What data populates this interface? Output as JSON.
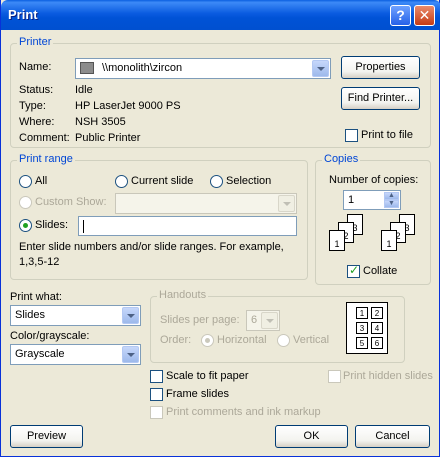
{
  "window": {
    "title": "Print",
    "help_label": "?",
    "close_label": "✕"
  },
  "printer": {
    "group_label": "Printer",
    "name_label": "Name:",
    "name_value": "\\\\monolith\\zircon",
    "properties_label": "Properties",
    "find_printer_label": "Find Printer...",
    "status_label": "Status:",
    "status_value": "Idle",
    "type_label": "Type:",
    "type_value": "HP LaserJet 9000 PS",
    "where_label": "Where:",
    "where_value": "NSH 3505",
    "comment_label": "Comment:",
    "comment_value": "Public Printer",
    "print_to_file_label": "Print to file",
    "print_to_file_checked": false
  },
  "print_range": {
    "group_label": "Print range",
    "all_label": "All",
    "current_slide_label": "Current slide",
    "selection_label": "Selection",
    "custom_show_label": "Custom Show:",
    "slides_label": "Slides:",
    "slides_value": "",
    "selected": "slides",
    "hint": "Enter slide numbers and/or slide ranges. For example, 1,3,5-12"
  },
  "copies": {
    "group_label": "Copies",
    "number_label": "Number of copies:",
    "number_value": "1",
    "collate_label": "Collate",
    "collate_checked": true,
    "collate_pages_a": [
      "1",
      "2",
      "3"
    ],
    "collate_pages_b": [
      "1",
      "2",
      "3"
    ]
  },
  "print_what": {
    "label": "Print what:",
    "value": "Slides"
  },
  "color": {
    "label": "Color/grayscale:",
    "value": "Grayscale"
  },
  "handouts": {
    "group_label": "Handouts",
    "slides_per_page_label": "Slides per page:",
    "slides_per_page_value": "6",
    "order_label": "Order:",
    "horizontal_label": "Horizontal",
    "vertical_label": "Vertical",
    "preview_cells": [
      "1",
      "2",
      "3",
      "4",
      "5",
      "6"
    ]
  },
  "options": {
    "scale_to_fit_label": "Scale to fit paper",
    "frame_slides_label": "Frame slides",
    "print_comments_label": "Print comments and ink markup",
    "print_hidden_label": "Print hidden slides"
  },
  "buttons": {
    "preview_label": "Preview",
    "ok_label": "OK",
    "cancel_label": "Cancel"
  }
}
